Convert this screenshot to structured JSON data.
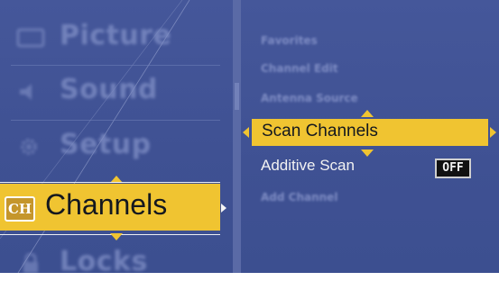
{
  "main_menu": {
    "items": [
      {
        "label": "Picture",
        "icon": "picture-icon"
      },
      {
        "label": "Sound",
        "icon": "speaker-icon"
      },
      {
        "label": "Setup",
        "icon": "gear-icon"
      },
      {
        "label": "Channels",
        "icon": "ch-icon",
        "icon_text": "CH",
        "selected": true
      },
      {
        "label": "Locks",
        "icon": "lock-icon"
      }
    ]
  },
  "sub_menu": {
    "items": [
      {
        "label": "Favorites"
      },
      {
        "label": "Channel Edit"
      },
      {
        "label": "Antenna Source"
      },
      {
        "label": "Scan Channels",
        "selected": true
      },
      {
        "label": "Additive Scan",
        "value": "OFF"
      },
      {
        "label": "Add Channel"
      }
    ]
  },
  "colors": {
    "panel_bg": "#3f5193",
    "highlight": "#f0c431",
    "text_dark": "#14181f",
    "text_light": "#f2f2f2"
  }
}
